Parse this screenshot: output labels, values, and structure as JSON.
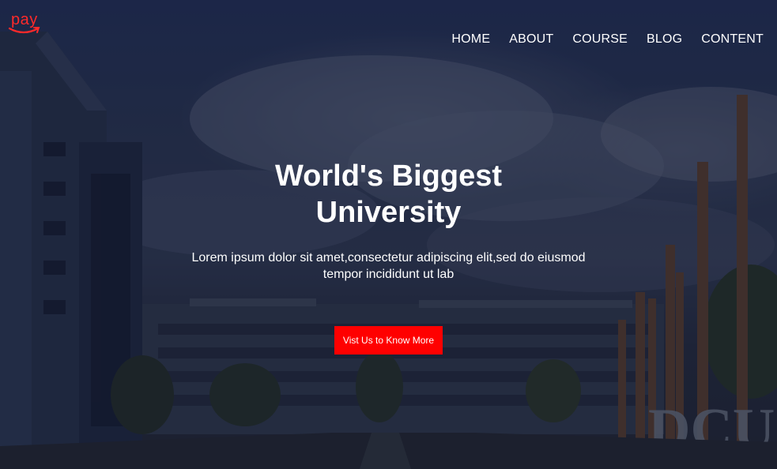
{
  "brand": {
    "logo_text": "pay",
    "accent_color": "#ff0000"
  },
  "nav": {
    "items": [
      {
        "label": "HOME"
      },
      {
        "label": "ABOUT"
      },
      {
        "label": "COURSE"
      },
      {
        "label": "BLOG"
      },
      {
        "label": "CONTENT"
      }
    ]
  },
  "hero": {
    "title": "World's Biggest University",
    "subtitle": "Lorem ipsum dolor sit amet,consectetur adipiscing elit,sed do eiusmod tempor incididunt ut lab",
    "cta_label": "Vist Us to Know More",
    "sign_text": "DCU"
  }
}
